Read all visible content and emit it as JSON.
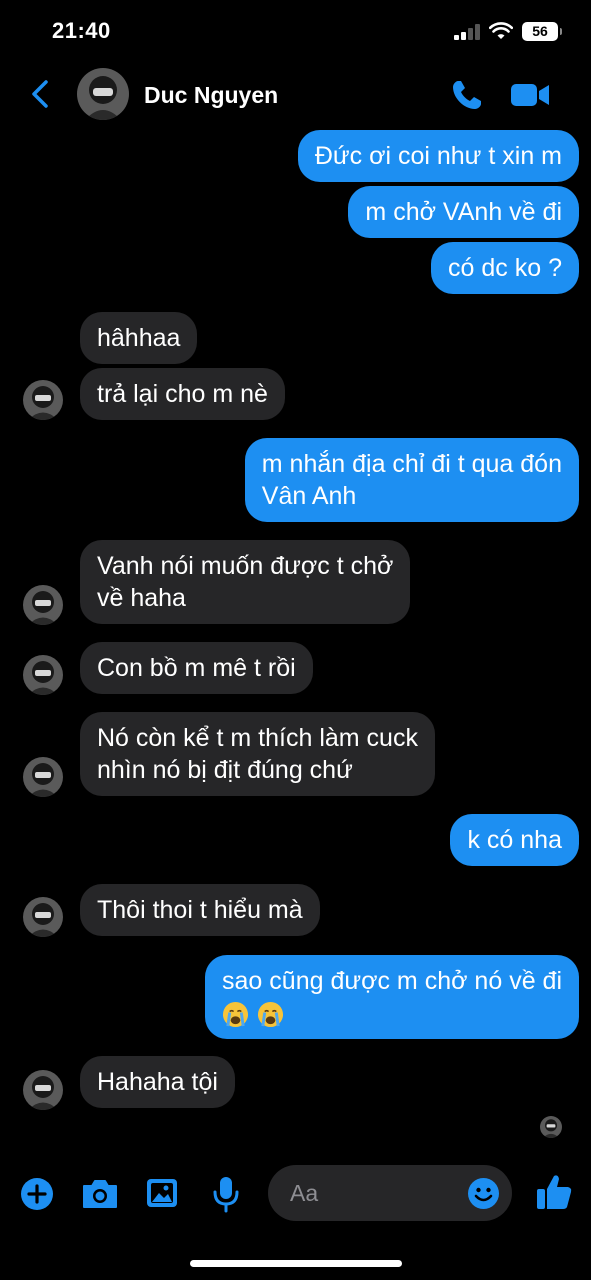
{
  "status": {
    "time": "21:40",
    "battery": "56"
  },
  "header": {
    "name": "Duc Nguyen"
  },
  "messages": {
    "m1": "Đức ơi coi như t xin m",
    "m2": "m chở VAnh về đi",
    "m3": "có dc ko ?",
    "m4": "hâhhaa",
    "m5": "trả lại cho m nè",
    "m6_l1": "m nhắn địa chỉ đi t qua đón",
    "m6_l2": "Vân Anh",
    "m7_l1": "Vanh nói muốn được t chở",
    "m7_l2": "về haha",
    "m8": "Con bồ m mê t rồi",
    "m9_l1": "Nó còn kể t m thích làm cuck",
    "m9_l2": "nhìn nó bị địt đúng chứ",
    "m10": "k có nha",
    "m11": "Thôi thoi t hiểu mà",
    "m12": "sao cũng được m chở nó về đi",
    "m13": "Hahaha tội"
  },
  "composer": {
    "placeholder": "Aa"
  },
  "colors": {
    "accent": "#1d8ff2",
    "incoming": "#262628",
    "background": "#000000"
  },
  "icons": [
    "back-chevron-icon",
    "phone-icon",
    "video-camera-icon",
    "plus-icon",
    "camera-icon",
    "image-icon",
    "microphone-icon",
    "smiley-icon",
    "thumbs-up-icon",
    "crying-face-emoji"
  ]
}
